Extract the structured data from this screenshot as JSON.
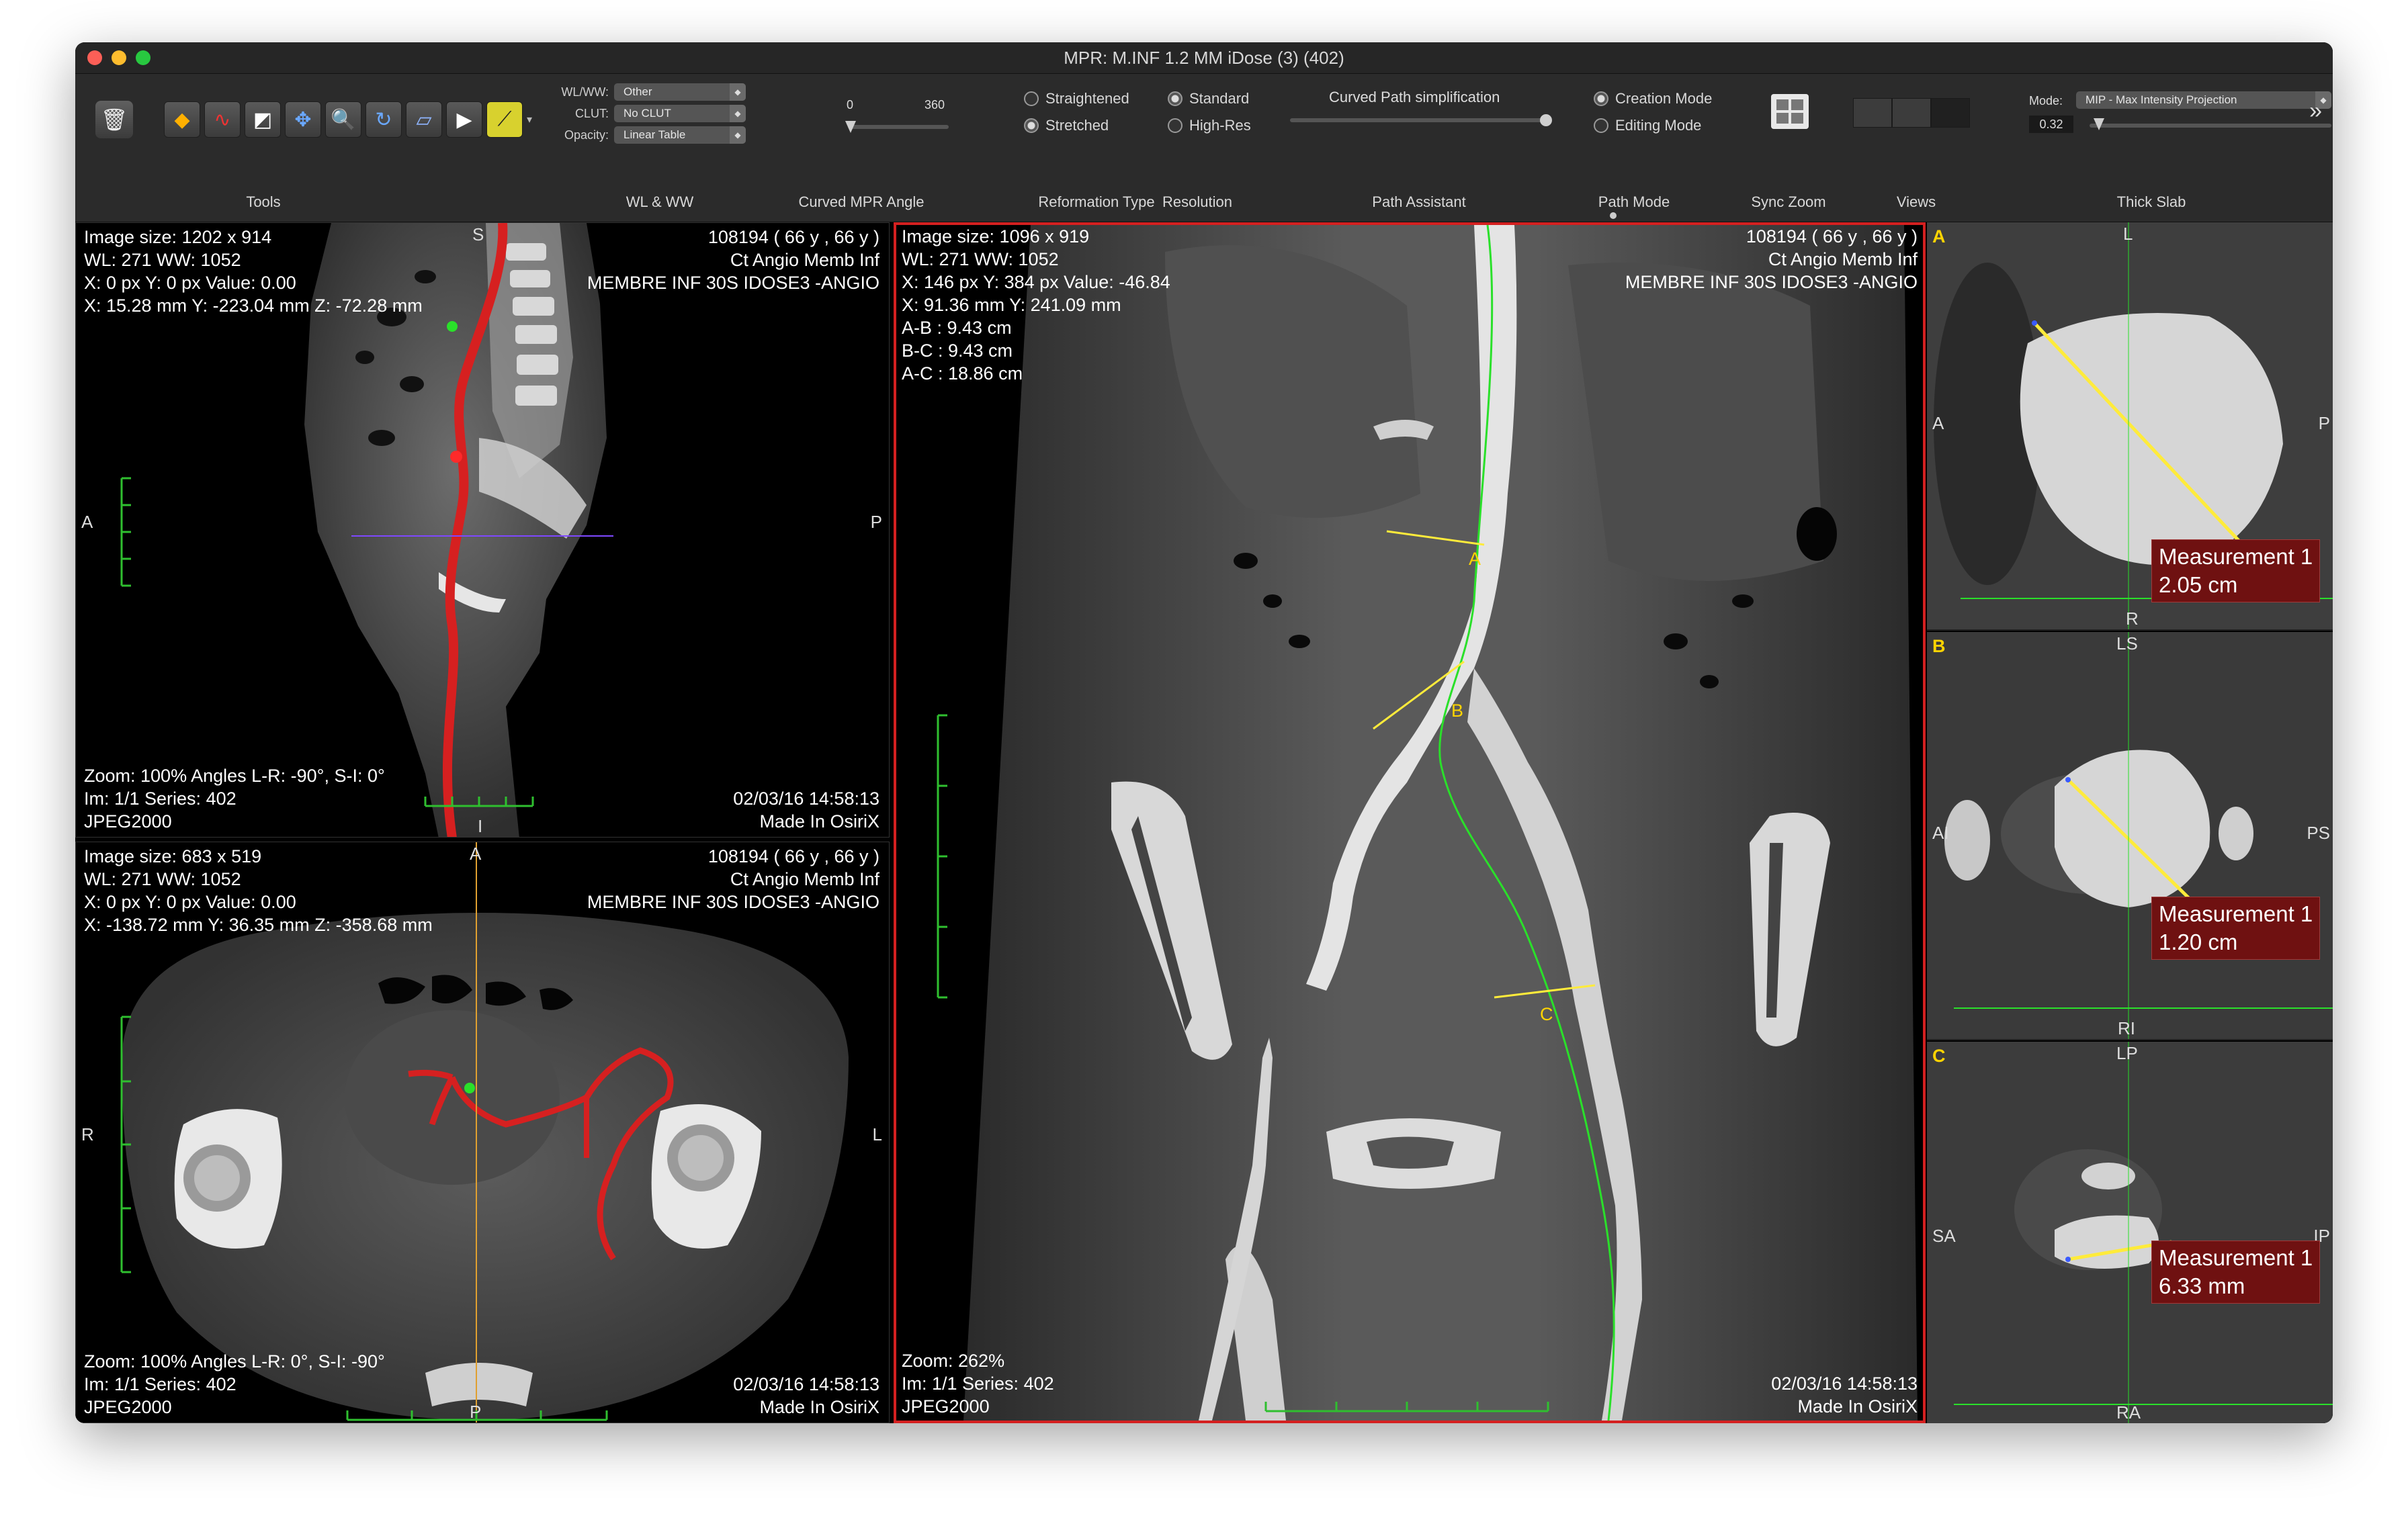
{
  "window": {
    "title": "MPR: M.INF 1.2 MM iDose (3) (402)"
  },
  "toolbar": {
    "groups": {
      "tools": "Tools",
      "wlww": "WL & WW",
      "curved_mpr_angle": "Curved MPR Angle",
      "reformation_type": "Reformation Type",
      "resolution": "Resolution",
      "path_assistant": "Path Assistant",
      "path_mode": "Path Mode",
      "sync_zoom": "Sync Zoom",
      "views": "Views",
      "thick_slab": "Thick Slab"
    },
    "wlww_label": "WL/WW:",
    "wlww_value": "Other",
    "clut_label": "CLUT:",
    "clut_value": "No CLUT",
    "opacity_label": "Opacity:",
    "opacity_value": "Linear Table",
    "angle_min": "0",
    "angle_max": "360",
    "reformation": {
      "straightened": "Straightened",
      "stretched": "Stretched",
      "selected": "Stretched"
    },
    "resolution_opts": {
      "standard": "Standard",
      "high_res": "High-Res",
      "selected": "Standard"
    },
    "curved_path_simplification": "Curved Path simplification",
    "path_mode_opts": {
      "creation": "Creation Mode",
      "editing": "Editing Mode",
      "selected": "Creation Mode"
    },
    "thick_slab_mode_label": "Mode:",
    "thick_slab_mode": "MIP - Max Intensity Projection",
    "thick_slab_value": "0.32",
    "overflow": "»"
  },
  "panels": {
    "sagittal": {
      "tl": [
        "Image size: 1202 x 914",
        "WL: 271 WW: 1052",
        "X: 0 px Y: 0 px Value: 0.00",
        "X: 15.28 mm Y: -223.04 mm Z: -72.28 mm"
      ],
      "tr": [
        "108194 (  66 y ,  66 y )",
        "Ct Angio Memb Inf",
        "MEMBRE INF 30S IDOSE3 -ANGIO"
      ],
      "bl": [
        "Zoom: 100% Angles L-R: -90°, S-I: 0°",
        "Im: 1/1  Series: 402",
        "JPEG2000"
      ],
      "br": [
        "02/03/16 14:58:13",
        "Made In OsiriX"
      ],
      "top": "S",
      "left": "A",
      "right": "P",
      "bottom": "I"
    },
    "axial": {
      "tl": [
        "Image size: 683 x 519",
        "WL: 271 WW: 1052",
        "X: 0 px Y: 0 px Value: 0.00",
        "X: -138.72 mm Y: 36.35 mm Z: -358.68 mm"
      ],
      "tr": [
        "108194 (  66 y ,  66 y )",
        "Ct Angio Memb Inf",
        "MEMBRE INF 30S IDOSE3 -ANGIO"
      ],
      "bl": [
        "Zoom: 100% Angles L-R: 0°, S-I: -90°",
        "Im: 1/1  Series: 402",
        "JPEG2000"
      ],
      "br": [
        "02/03/16 14:58:13",
        "Made In OsiriX"
      ],
      "top": "A",
      "left": "R",
      "right": "L",
      "bottom": "P"
    },
    "curved": {
      "tl": [
        "Image size: 1096 x 919",
        "WL: 271 WW: 1052",
        "X: 146 px Y: 384 px Value: -46.84",
        "X: 91.36 mm Y: 241.09 mm",
        "A-B : 9.43 cm",
        "B-C : 9.43 cm",
        "A-C : 18.86 cm"
      ],
      "tr": [
        "108194 (  66 y ,  66 y )",
        "Ct Angio Memb Inf",
        "MEMBRE INF 30S IDOSE3 -ANGIO"
      ],
      "bl": [
        "Zoom: 262%",
        "Im: 1/1  Series: 402",
        "JPEG2000"
      ],
      "br": [
        "02/03/16 14:58:13",
        "Made In OsiriX"
      ],
      "markers": [
        "A",
        "B",
        "C"
      ]
    },
    "cross_a": {
      "letter": "A",
      "top": "L",
      "left": "A",
      "right": "P",
      "bottom": "R",
      "measurement": "Measurement 1\n2.05 cm"
    },
    "cross_b": {
      "letter": "B",
      "top": "LS",
      "left": "AI",
      "right": "PS",
      "bottom": "RI",
      "measurement": "Measurement 1\n1.20 cm"
    },
    "cross_c": {
      "letter": "C",
      "top": "LP",
      "left": "SA",
      "right": "IP",
      "bottom": "RA",
      "measurement": "Measurement 1\n6.33 mm"
    }
  }
}
